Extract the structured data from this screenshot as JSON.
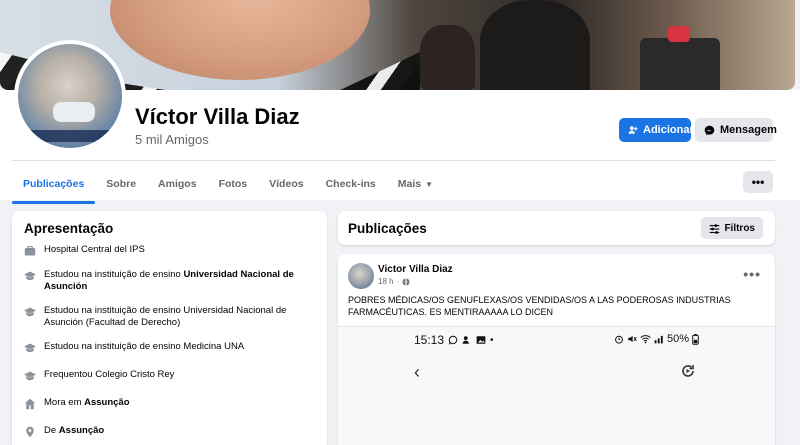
{
  "profile": {
    "name": "Víctor Villa Diaz",
    "friends": "5 mil Amigos",
    "add_label": "Adicionar",
    "message_label": "Mensagem"
  },
  "tabs": [
    {
      "label": "Publicações",
      "active": true
    },
    {
      "label": "Sobre"
    },
    {
      "label": "Amigos"
    },
    {
      "label": "Fotos"
    },
    {
      "label": "Vídeos"
    },
    {
      "label": "Check-ins"
    },
    {
      "label": "Mais"
    }
  ],
  "more_button": "•••",
  "intro": {
    "title": "Apresentação",
    "items": [
      {
        "icon": "briefcase-icon",
        "text_plain": "Hospital Central del IPS"
      },
      {
        "icon": "graduation-cap-icon",
        "prefix": "Estudou na instituição de ensino ",
        "bold": "Universidad Nacional de Asunción"
      },
      {
        "icon": "graduation-cap-icon",
        "text_plain": "Estudou na instituição de ensino Universidad Nacional de Asunción (Facultad de Derecho)"
      },
      {
        "icon": "graduation-cap-icon",
        "text_plain": "Estudou na instituição de ensino Medicina UNA"
      },
      {
        "icon": "graduation-cap-icon",
        "text_plain": "Frequentou Colegio Cristo Rey"
      },
      {
        "icon": "home-icon",
        "prefix": "Mora em ",
        "bold": "Assunção"
      },
      {
        "icon": "location-pin-icon",
        "prefix": "De ",
        "bold": "Assunção"
      }
    ]
  },
  "posts_section": {
    "title": "Publicações",
    "filter_label": "Filtros"
  },
  "post": {
    "author": "Victor Villa Diaz",
    "time": "18 h",
    "text": "POBRES MÉDICAS/OS GENUFLEXAS/OS VENDIDAS/OS A LAS PODEROSAS INDUSTRIAS FARMACÉUTICAS. ES MENTIRAAAAA LO DICEN",
    "phone_time": "15:13",
    "phone_battery": "50%"
  },
  "colors": {
    "accent": "#1b74e4",
    "page_bg": "#f0f2f5"
  }
}
